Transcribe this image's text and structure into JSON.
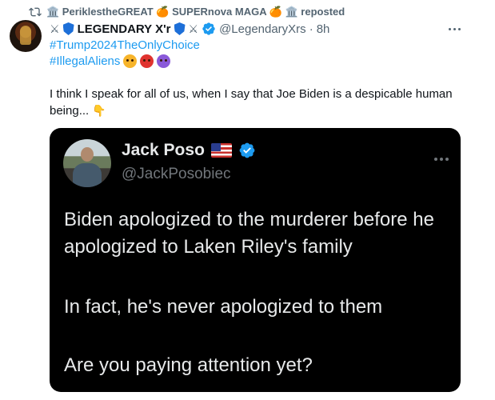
{
  "repost": {
    "text": "🏛️ PeriklestheGREAT 🍊 SUPERnova MAGA 🍊 🏛️ reposted"
  },
  "author": {
    "display_name": "LEGENDARY X'r",
    "handle": "@LegendaryXrs",
    "separator": "·",
    "time": "8h"
  },
  "post": {
    "hashtag1": "#Trump2024TheOnlyChoice",
    "hashtag2": "#IllegalAliens",
    "text": "I think I speak for all of us, when I say that Joe Biden is a despicable human being...",
    "emoji_end": "👇"
  },
  "quote": {
    "name": "Jack Poso",
    "handle": "@JackPosobiec",
    "line1": "Biden apologized to the murderer before he apologized to Laken Riley's family",
    "line2": "In fact, he's never apologized to them",
    "line3": "Are you paying attention yet?"
  },
  "icons": {
    "repost": "repost-icon",
    "more": "more-horizontal-icon",
    "verified": "verified-badge-icon",
    "flag": "us-flag-icon",
    "shield": "shield-icon",
    "swords": "crossed-swords-icon"
  },
  "colors": {
    "link": "#1d9bf0",
    "muted": "#536471",
    "verified": "#1d9bf0",
    "quote_bg": "#000000",
    "quote_text": "#e7e9ea"
  }
}
